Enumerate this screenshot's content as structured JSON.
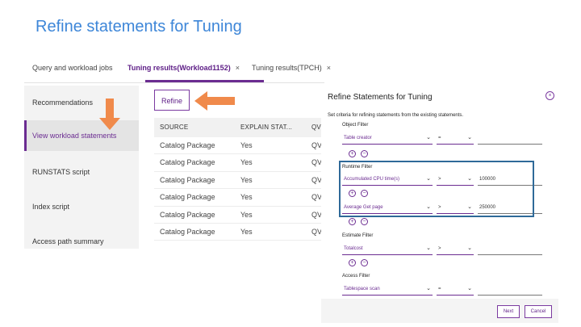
{
  "slide_title": "Refine statements for Tuning",
  "tabs": [
    {
      "label": "Query and workload jobs",
      "close": ""
    },
    {
      "label": "Tuning results(Workload1152)",
      "close": "×"
    },
    {
      "label": "Tuning results(TPCH)",
      "close": "×"
    }
  ],
  "nav": [
    "Recommendations",
    "View workload statements",
    "RUNSTATS script",
    "Index script",
    "Access path summary"
  ],
  "refine_label": "Refine",
  "table": {
    "headers": [
      "SOURCE",
      "EXPLAIN STAT...",
      "QV"
    ],
    "rows": [
      [
        "Catalog Package",
        "Yes",
        "QV"
      ],
      [
        "Catalog Package",
        "Yes",
        "QV"
      ],
      [
        "Catalog Package",
        "Yes",
        "QV"
      ],
      [
        "Catalog Package",
        "Yes",
        "QV"
      ],
      [
        "Catalog Package",
        "Yes",
        "QV"
      ],
      [
        "Catalog Package",
        "Yes",
        "QV"
      ]
    ]
  },
  "dialog": {
    "title": "Refine Statements for Tuning",
    "close": "×",
    "description": "Set criteria for refining statements from the existing statements.",
    "object_filter": {
      "label": "Object Filter",
      "field": "Table creator",
      "op": "="
    },
    "runtime_filter": {
      "label": "Runtime Filter",
      "rows": [
        {
          "field": "Accumulated CPU time(s)",
          "op": ">",
          "value": "100000"
        },
        {
          "field": "Average Get page",
          "op": ">",
          "value": "250000"
        }
      ]
    },
    "estimate_filter": {
      "label": "Estimate Filter",
      "field": "Totalcost",
      "op": ">"
    },
    "access_filter": {
      "label": "Access Filter",
      "field": "Tablespace scan",
      "op": "="
    },
    "plus": "+",
    "minus": "−",
    "next_label": "Next",
    "cancel_label": "Cancel"
  },
  "colors": {
    "accent": "#6b2c91",
    "arrow": "#f08a4b",
    "highlight": "#2f6a99",
    "title": "#3d86d8"
  }
}
